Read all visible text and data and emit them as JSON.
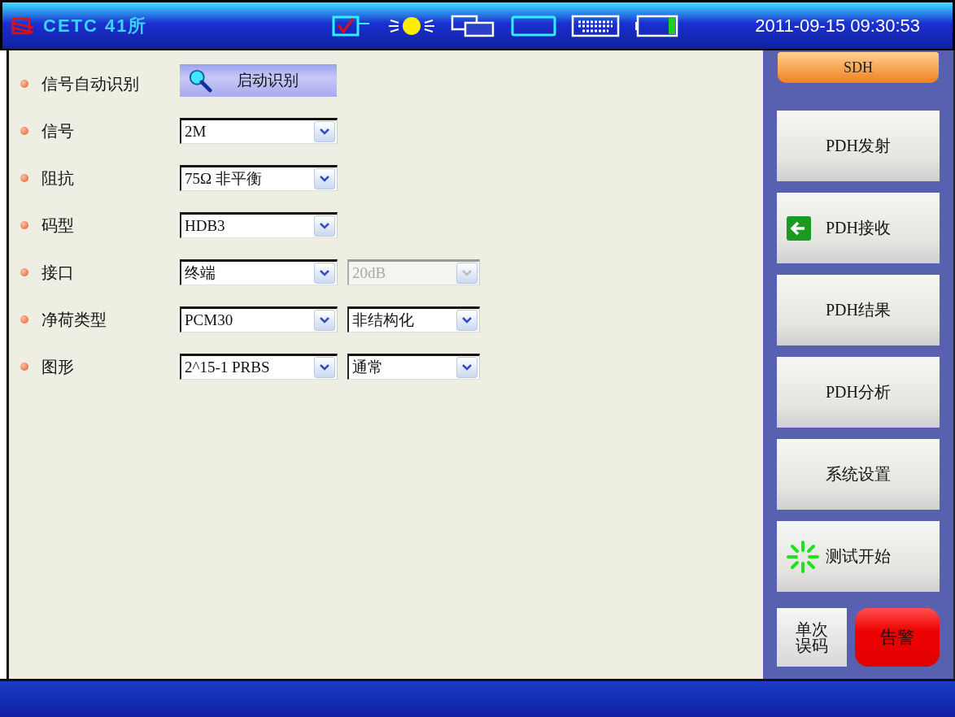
{
  "header": {
    "logo": "CETC 41所",
    "datetime": "2011-09-15 09:30:53"
  },
  "form": [
    {
      "label": "信号自动识别",
      "kind": "button",
      "button": "启动识别"
    },
    {
      "label": "信号",
      "kind": "select",
      "selects": [
        {
          "value": "2M",
          "disabled": false
        }
      ]
    },
    {
      "label": "阻抗",
      "kind": "select",
      "selects": [
        {
          "value": "75Ω 非平衡",
          "disabled": false
        }
      ]
    },
    {
      "label": "码型",
      "kind": "select",
      "selects": [
        {
          "value": "HDB3",
          "disabled": false
        }
      ]
    },
    {
      "label": "接口",
      "kind": "select",
      "selects": [
        {
          "value": "终端",
          "disabled": false
        },
        {
          "value": "20dB",
          "disabled": true
        }
      ]
    },
    {
      "label": "净荷类型",
      "kind": "select",
      "selects": [
        {
          "value": "PCM30",
          "disabled": false
        },
        {
          "value": "非结构化",
          "disabled": false
        }
      ]
    },
    {
      "label": "图形",
      "kind": "select",
      "selects": [
        {
          "value": "2^15-1 PRBS",
          "disabled": false
        },
        {
          "value": "通常",
          "disabled": false
        }
      ]
    }
  ],
  "sidebar": {
    "mode_tab": "SDH",
    "buttons": [
      {
        "label": "PDH发射",
        "kind": "plain"
      },
      {
        "label": "PDH接收",
        "kind": "arrow"
      },
      {
        "label": "PDH结果",
        "kind": "plain"
      },
      {
        "label": "PDH分析",
        "kind": "plain"
      },
      {
        "label": "系统设置",
        "kind": "plain"
      },
      {
        "label": "测试开始",
        "kind": "spinner"
      }
    ],
    "single_error": "单次误码",
    "alarm": "告警"
  }
}
